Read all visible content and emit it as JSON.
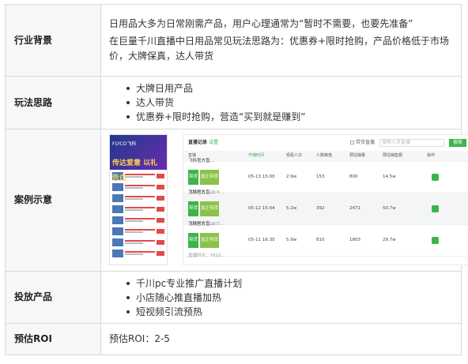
{
  "rows": {
    "background": {
      "label": "行业背景",
      "paragraphs": [
        "日用品大多为日常刚需产品，用户心理通常为“暂时不需要，也要先准备”",
        "在巨量千川直播中日用品常见玩法思路为：优惠券+限时抢购，产品价格低于市场价，大牌保真，达人带货"
      ]
    },
    "tactics": {
      "label": "玩法思路",
      "items": [
        "大牌日用产品",
        "达人带货",
        "优惠券+限时抢购，营造“买到就是赚到”"
      ]
    },
    "example": {
      "label": "案例示意",
      "phone": {
        "header": "FLYCO飞科",
        "banner": "传达爱意 以礼告白"
      },
      "panel": {
        "title": "直播记录",
        "title_link": "设置",
        "checkbox_label": "带货直播",
        "search_placeholder": "搜索人员直播",
        "search_button": "搜索",
        "columns": [
          "直播",
          "开播时间",
          "观看人次",
          "人数峰值",
          "预估销量",
          "预估销售额",
          "操作"
        ],
        "rows": [
          {
            "name": "飞科官方直...",
            "tag1": "带货",
            "tag2": "加正带货",
            "sub": "直播时长：08/4...",
            "time": "05-13 15:00",
            "views": "2.9w",
            "peak": "153",
            "sales": "800",
            "revenue": "14.5w"
          },
          {
            "name": "飞科官方直...",
            "tag1": "带货",
            "tag2": "加正带货",
            "sub": "直播时长：08/3...",
            "time": "05-12 15:04",
            "views": "5.2w",
            "peak": "392",
            "sales": "2471",
            "revenue": "50.7w"
          },
          {
            "name": "飞科官方直...",
            "tag1": "带货",
            "tag2": "加正带货",
            "sub": "直播时长：7812...",
            "time": "05-11 16:30",
            "views": "5.9w",
            "peak": "810",
            "sales": "1803",
            "revenue": "29.7w"
          }
        ]
      }
    },
    "products": {
      "label": "投放产品",
      "items": [
        "千川pc专业推广直播计划",
        "小店随心推直播加热",
        "短视频引流预热"
      ]
    },
    "roi": {
      "label": "预估ROI",
      "text": "预估ROI：2-5"
    }
  }
}
